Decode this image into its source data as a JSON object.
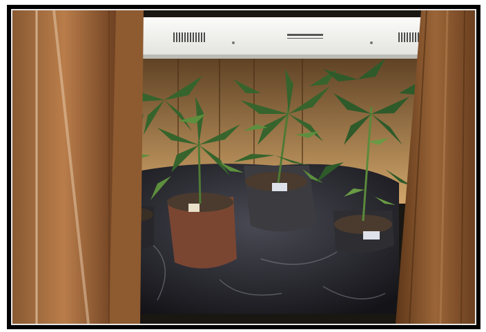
{
  "photo": {
    "subject": "",
    "colors": {
      "frame": "#000000",
      "border": "#e8e8e8",
      "wood_dark": "#7a4a26",
      "wood_light": "#c08a58",
      "light_panel": "#f2f2ef",
      "leaf_dark": "#2f5a2a",
      "leaf_light": "#5d8f3e",
      "plastic": "#2b2b31",
      "soil": "#4a3b2e"
    }
  }
}
